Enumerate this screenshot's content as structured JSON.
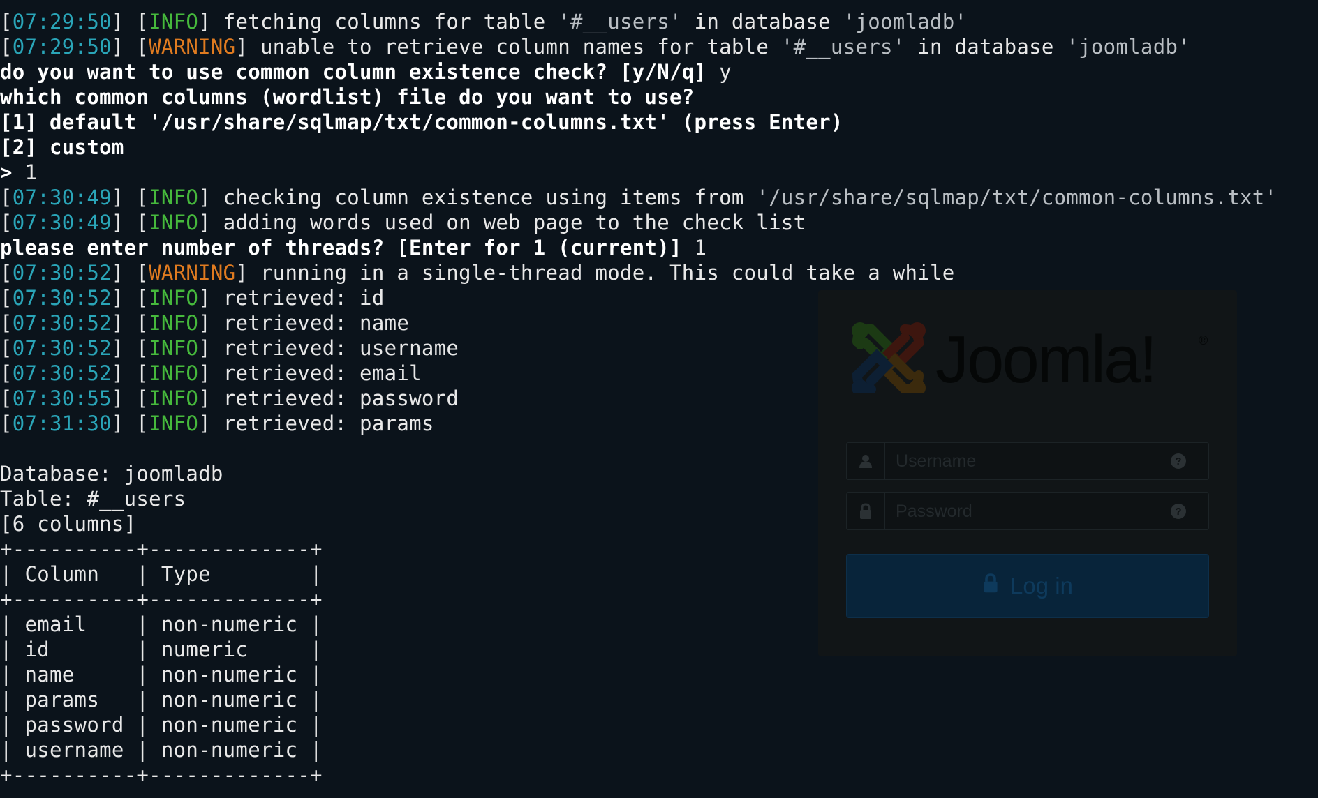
{
  "terminal": {
    "lines": [
      {
        "type": "log",
        "time": "07:29:50",
        "level": "INFO",
        "msg_parts": [
          "fetching columns for table ",
          "'#__users'",
          " in database ",
          "'joomladb'"
        ]
      },
      {
        "type": "log",
        "time": "07:29:50",
        "level": "WARNING",
        "msg_parts": [
          "unable to retrieve column names for table ",
          "'#__users'",
          " in database ",
          "'joomladb'"
        ]
      },
      {
        "type": "prompt",
        "text": "do you want to use common column existence check? [y/N/q]",
        "answer": "y"
      },
      {
        "type": "prompt",
        "text": "which common columns (wordlist) file do you want to use?",
        "answer": ""
      },
      {
        "type": "prompt",
        "text": "[1] default '/usr/share/sqlmap/txt/common-columns.txt' (press Enter)",
        "answer": ""
      },
      {
        "type": "prompt",
        "text": "[2] custom",
        "answer": ""
      },
      {
        "type": "input",
        "text": "> 1"
      },
      {
        "type": "log",
        "time": "07:30:49",
        "level": "INFO",
        "msg_parts": [
          "checking column existence using items from ",
          "'/usr/share/sqlmap/txt/common-columns.txt'"
        ]
      },
      {
        "type": "log",
        "time": "07:30:49",
        "level": "INFO",
        "msg_parts": [
          "adding words used on web page to the check list"
        ]
      },
      {
        "type": "prompt",
        "text": "please enter number of threads? [Enter for 1 (current)]",
        "answer": "1"
      },
      {
        "type": "log",
        "time": "07:30:52",
        "level": "WARNING",
        "msg_parts": [
          "running in a single-thread mode. This could take a while"
        ]
      },
      {
        "type": "log",
        "time": "07:30:52",
        "level": "INFO",
        "msg_parts": [
          "retrieved: id"
        ]
      },
      {
        "type": "log",
        "time": "07:30:52",
        "level": "INFO",
        "msg_parts": [
          "retrieved: name"
        ]
      },
      {
        "type": "log",
        "time": "07:30:52",
        "level": "INFO",
        "msg_parts": [
          "retrieved: username"
        ]
      },
      {
        "type": "log",
        "time": "07:30:52",
        "level": "INFO",
        "msg_parts": [
          "retrieved: email"
        ]
      },
      {
        "type": "log",
        "time": "07:30:55",
        "level": "INFO",
        "msg_parts": [
          "retrieved: password"
        ]
      },
      {
        "type": "log",
        "time": "07:31:30",
        "level": "INFO",
        "msg_parts": [
          "retrieved: params"
        ]
      },
      {
        "type": "plain",
        "text": ""
      },
      {
        "type": "plain",
        "text": "Database: joomladb"
      },
      {
        "type": "plain",
        "text": "Table: #__users"
      },
      {
        "type": "plain",
        "text": "[6 columns]"
      },
      {
        "type": "plain",
        "text": "+----------+-------------+"
      },
      {
        "type": "plain",
        "text": "| Column   | Type        |"
      },
      {
        "type": "plain",
        "text": "+----------+-------------+"
      },
      {
        "type": "plain",
        "text": "| email    | non-numeric |"
      },
      {
        "type": "plain",
        "text": "| id       | numeric     |"
      },
      {
        "type": "plain",
        "text": "| name     | non-numeric |"
      },
      {
        "type": "plain",
        "text": "| params   | non-numeric |"
      },
      {
        "type": "plain",
        "text": "| password | non-numeric |"
      },
      {
        "type": "plain",
        "text": "| username | non-numeric |"
      },
      {
        "type": "plain",
        "text": "+----------+-------------+"
      }
    ],
    "colors": {
      "timestamp": "#2aa5b8",
      "info": "#46b93c",
      "warning": "#e07b20",
      "quoted": "#b9bec3",
      "background": "#0b131b"
    }
  },
  "login": {
    "logo_text": "Joomla!",
    "logo_reg": "®",
    "username_placeholder": "Username",
    "password_placeholder": "Password",
    "login_label": "Log in",
    "icons": {
      "user": "user-icon",
      "lock": "lock-icon",
      "help": "question-circle-icon"
    }
  }
}
